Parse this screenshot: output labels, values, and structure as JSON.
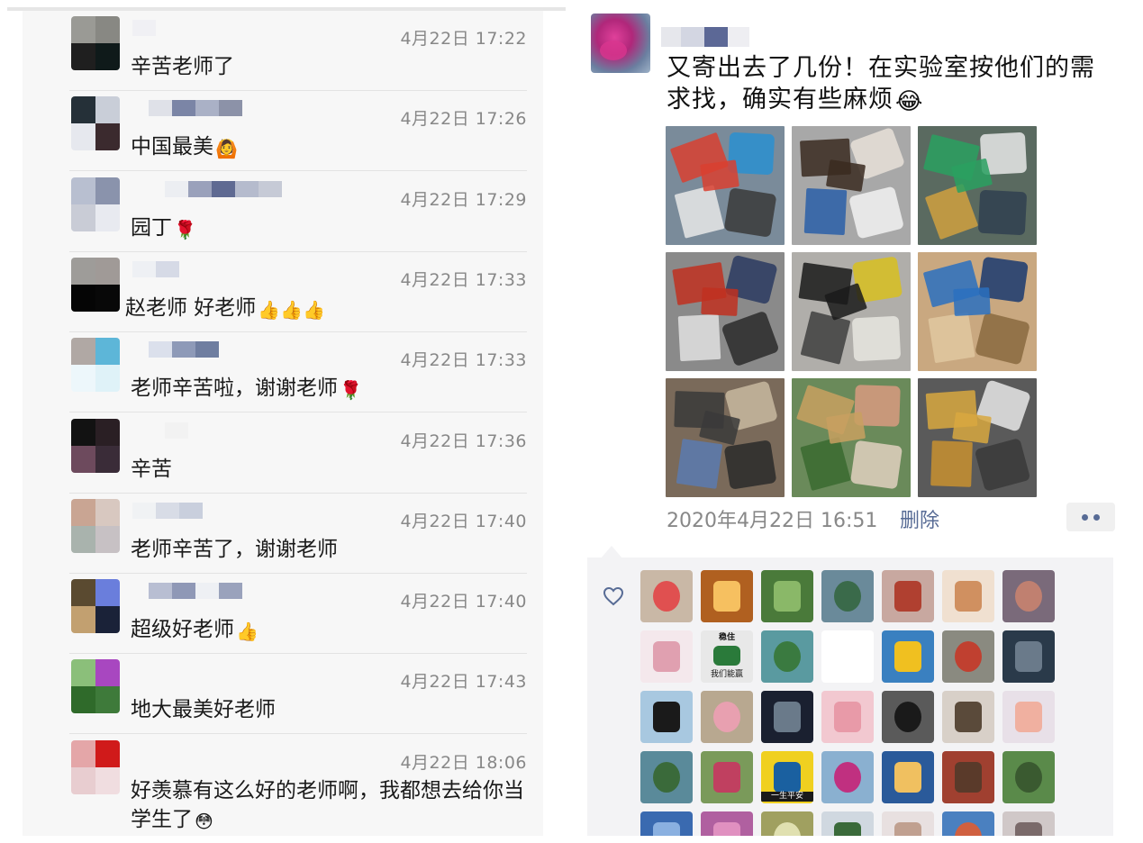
{
  "comments": [
    {
      "time": "4月22日 17:22",
      "text": "辛苦老师了",
      "emoji": "",
      "avatar": [
        "#9a9a95",
        "#888883",
        "#1f1f1f",
        "#0f1a1a"
      ],
      "name_blocks": [
        "#f0f0f4"
      ]
    },
    {
      "time": "4月22日 17:26",
      "text": "中国最美",
      "emoji": "🙆",
      "avatar": [
        "#253038",
        "#c9ced8",
        "#e6e8ee",
        "#3b2a2e"
      ],
      "name_blocks": [
        "#dfe1e8",
        "#7b85a6",
        "#aab1c6",
        "#8c92a8"
      ]
    },
    {
      "time": "4月22日 17:29",
      "text": "园丁",
      "emoji": "🌹",
      "avatar": [
        "#b8bfd0",
        "#8a93ac",
        "#c9ccd6",
        "#e8eaf0"
      ],
      "name_blocks": [
        "#eceef2",
        "#9aa1bb",
        "#5f6a92",
        "#b5bbcd",
        "#c6cad6"
      ]
    },
    {
      "time": "4月22日 17:33",
      "text": "赵老师 好老师",
      "emoji": "👍👍👍",
      "avatar": [
        "#9e9c99",
        "#a09a97",
        "#050505",
        "#080808"
      ],
      "name_blocks": [
        "#eef0f4",
        "#d6dae6"
      ]
    },
    {
      "time": "4月22日 17:33",
      "text": "老师辛苦啦，谢谢老师",
      "emoji": "🌹",
      "avatar": [
        "#b0a8a4",
        "#5db6d8",
        "#edf7fb",
        "#dff2f8"
      ],
      "name_blocks": [
        "#dbe0ec",
        "#8e9ab8",
        "#6f7ea0"
      ]
    },
    {
      "time": "4月22日 17:36",
      "text": "辛苦",
      "emoji": "",
      "avatar": [
        "#121212",
        "#2a1f24",
        "#6d4a5d",
        "#3a2c38"
      ],
      "name_blocks": [
        "#f2f2f2"
      ]
    },
    {
      "time": "4月22日 17:40",
      "text": "老师辛苦了，谢谢老师",
      "emoji": "",
      "avatar": [
        "#c9a593",
        "#d8c8c0",
        "#a9b3ad",
        "#c7c1c4"
      ],
      "name_blocks": [
        "#f0f2f4",
        "#d8dce6",
        "#c9cfdd"
      ]
    },
    {
      "time": "4月22日 17:40",
      "text": "超级好老师",
      "emoji": "👍",
      "avatar": [
        "#5a4a30",
        "#6a7edc",
        "#c2a070",
        "#1a2238"
      ],
      "name_blocks": [
        "#b8bed2",
        "#8f98b6",
        "#eef0f4",
        "#9aa2bc"
      ]
    },
    {
      "time": "4月22日 17:43",
      "text": "地大最美好老师",
      "emoji": "",
      "avatar": [
        "#8bbf7a",
        "#a847c0",
        "#2f6a2a",
        "#3e7a3a"
      ],
      "name_blocks": []
    },
    {
      "time": "4月22日 18:06",
      "text": "好羡慕有这么好的老师啊，我都想去给你当学生了",
      "emoji": "😳",
      "avatar": [
        "#e4a6a8",
        "#d01a1a",
        "#e8cdd0",
        "#f0dde0"
      ],
      "name_blocks": []
    }
  ],
  "post": {
    "text": "又寄出去了几份！在实验室按他们的需求找，确实有些麻烦",
    "emoji": "😂",
    "date": "2020年4月22日 16:51",
    "delete_label": "删除",
    "images": [
      {
        "name": "tools-on-table-photo",
        "bg": "#7a8b9a",
        "accents": [
          "#d94030",
          "#2a8fd0",
          "#e8e8e8",
          "#3a3a3a"
        ]
      },
      {
        "name": "drone-frame-photo",
        "bg": "#a8a8a8",
        "accents": [
          "#3a2a20",
          "#e8e0d8",
          "#2a5fa8",
          "#f2f2f2"
        ]
      },
      {
        "name": "lab-bench-photo",
        "bg": "#5a6a60",
        "accents": [
          "#2aa060",
          "#e8e8e8",
          "#d0a040",
          "#304050"
        ]
      },
      {
        "name": "electronics-board-photo",
        "bg": "#8a8a8a",
        "accents": [
          "#c03020",
          "#2a3a60",
          "#e0e0e0",
          "#2a2a2a"
        ]
      },
      {
        "name": "cables-tangle-photo",
        "bg": "#b0aeaa",
        "accents": [
          "#1a1a1a",
          "#d8c020",
          "#404040",
          "#e8e6e0"
        ]
      },
      {
        "name": "box-with-bag-photo",
        "bg": "#c9a880",
        "accents": [
          "#2a70c0",
          "#1a3a70",
          "#e0c8a0",
          "#8a6a40"
        ]
      },
      {
        "name": "package-wrapped-photo",
        "bg": "#7a6a5a",
        "accents": [
          "#3a3a3a",
          "#c8b8a0",
          "#5a7ab0",
          "#2a2a2a"
        ]
      },
      {
        "name": "boxes-on-cart-photo",
        "bg": "#6a8a5a",
        "accents": [
          "#c8a060",
          "#d89a80",
          "#3a6a30",
          "#e0d0c0"
        ]
      },
      {
        "name": "boxes-on-floor-photo",
        "bg": "#5a5a5a",
        "accents": [
          "#d8a840",
          "#e8e8e8",
          "#c89030",
          "#3a3a3a"
        ]
      }
    ]
  },
  "likes": {
    "avatars": [
      {
        "bg": "#c9b8a6",
        "fg": "#e05050",
        "cap": ""
      },
      {
        "bg": "#b06020",
        "fg": "#f6c060",
        "cap": ""
      },
      {
        "bg": "#4a7a3a",
        "fg": "#8ab868",
        "cap": ""
      },
      {
        "bg": "#6a8a9a",
        "fg": "#3a6a4a",
        "cap": ""
      },
      {
        "bg": "#c8a8a0",
        "fg": "#b04030",
        "cap": ""
      },
      {
        "bg": "#f0e0d0",
        "fg": "#d09060",
        "cap": ""
      },
      {
        "bg": "#7a6a7a",
        "fg": "#c08070",
        "cap": ""
      },
      {
        "bg": "#f4e8ec",
        "fg": "#e0a0b0",
        "cap": ""
      },
      {
        "bg": "#e8e8e8",
        "fg": "#2a6a3a",
        "cap": "稳住"
      },
      {
        "bg": "#5a9aa0",
        "fg": "#3a7a40",
        "cap": ""
      },
      {
        "bg": "#ffffff",
        "fg": "#ffffff",
        "cap": ""
      },
      {
        "bg": "#3a80c0",
        "fg": "#f0c020",
        "cap": ""
      },
      {
        "bg": "#8a8a80",
        "fg": "#c04030",
        "cap": ""
      },
      {
        "bg": "#2a3a4a",
        "fg": "#6a7a8a",
        "cap": ""
      },
      {
        "bg": "#a8c8e0",
        "fg": "#1a1a1a",
        "cap": ""
      },
      {
        "bg": "#b8a890",
        "fg": "#e8a0b0",
        "cap": ""
      },
      {
        "bg": "#1a2030",
        "fg": "#6a7a8a",
        "cap": ""
      },
      {
        "bg": "#f2c8d0",
        "fg": "#e89aa8",
        "cap": ""
      },
      {
        "bg": "#5a5a5a",
        "fg": "#1a1a1a",
        "cap": ""
      },
      {
        "bg": "#d8d0c8",
        "fg": "#5a4a3a",
        "cap": ""
      },
      {
        "bg": "#e8e0e8",
        "fg": "#f0b0a0",
        "cap": ""
      },
      {
        "bg": "#5a8a9a",
        "fg": "#3a6a3a",
        "cap": ""
      },
      {
        "bg": "#7a9a5a",
        "fg": "#c04060",
        "cap": ""
      },
      {
        "bg": "#f0d020",
        "fg": "#1a60a0",
        "cap": "一生平安"
      },
      {
        "bg": "#8ab0d0",
        "fg": "#c03080",
        "cap": ""
      },
      {
        "bg": "#2a5a9a",
        "fg": "#f0c060",
        "cap": ""
      },
      {
        "bg": "#a04030",
        "fg": "#5a3a2a",
        "cap": ""
      },
      {
        "bg": "#5a8a4a",
        "fg": "#3a5a30",
        "cap": ""
      },
      {
        "bg": "#3a6ab0",
        "fg": "#8ab0e0",
        "cap": ""
      },
      {
        "bg": "#b060a0",
        "fg": "#e090c0",
        "cap": ""
      },
      {
        "bg": "#a0a060",
        "fg": "#e0e0b0",
        "cap": ""
      },
      {
        "bg": "#d0d8e0",
        "fg": "#3a6a3a",
        "cap": ""
      },
      {
        "bg": "#e8e0e0",
        "fg": "#c0a090",
        "cap": ""
      },
      {
        "bg": "#4a80c0",
        "fg": "#d06040",
        "cap": ""
      },
      {
        "bg": "#d0c8c8",
        "fg": "#7a6a6a",
        "cap": ""
      }
    ],
    "avatar_texts": {
      "a9_line1": "稳住",
      "a9_line2": "我们能赢",
      "a24_line": "一生平安"
    }
  }
}
